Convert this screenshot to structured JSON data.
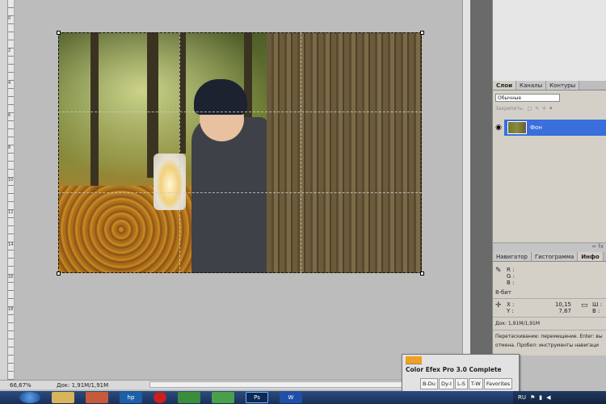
{
  "status": {
    "zoom": "66,67%",
    "doc": "Док: 1,91M/1,91M"
  },
  "layers_panel": {
    "tabs": [
      "Слои",
      "Каналы",
      "Контуры"
    ],
    "blend_mode": "Обычные",
    "lock_label": "Закрепить:",
    "layer_name": "Фон",
    "footer_icons": "∞ fx"
  },
  "info_panel": {
    "tabs": [
      "Навигатор",
      "Гистограмма",
      "Инфо"
    ],
    "rgb_labels": [
      "R :",
      "G :",
      "B :"
    ],
    "bit_depth": "8-бит",
    "x_label": "X :",
    "y_label": "Y :",
    "x_value": "10,15",
    "y_value": "7,67",
    "w_label": "Ш :",
    "h_label": "В :",
    "doc": "Док: 1,91M/1,91M",
    "hint_line1": "Перетаскивание: перемещение. Enter: вы",
    "hint_line2": "отмена. Пробел: инструменты навигаци"
  },
  "efex": {
    "title": "Color Efex Pro 3.0 Complete",
    "buttons": [
      "B-Du",
      "Dy-I",
      "L-S",
      "T-W",
      "Favorites"
    ]
  },
  "taskbar": {
    "items": [
      "",
      "",
      "",
      "hp",
      "",
      "",
      "",
      "Ps",
      "W"
    ],
    "lang": "RU",
    "tray_icons": [
      "flag-icon",
      "network-icon",
      "volume-icon"
    ]
  },
  "ruler": {
    "ticks": [
      "0",
      "2",
      "4",
      "6",
      "8",
      "10",
      "12",
      "14",
      "16",
      "18"
    ]
  },
  "colors": {
    "selection": "#3a6fdc",
    "efex_title_accent": "#f0a020",
    "taskbar": "#1a2f57"
  }
}
